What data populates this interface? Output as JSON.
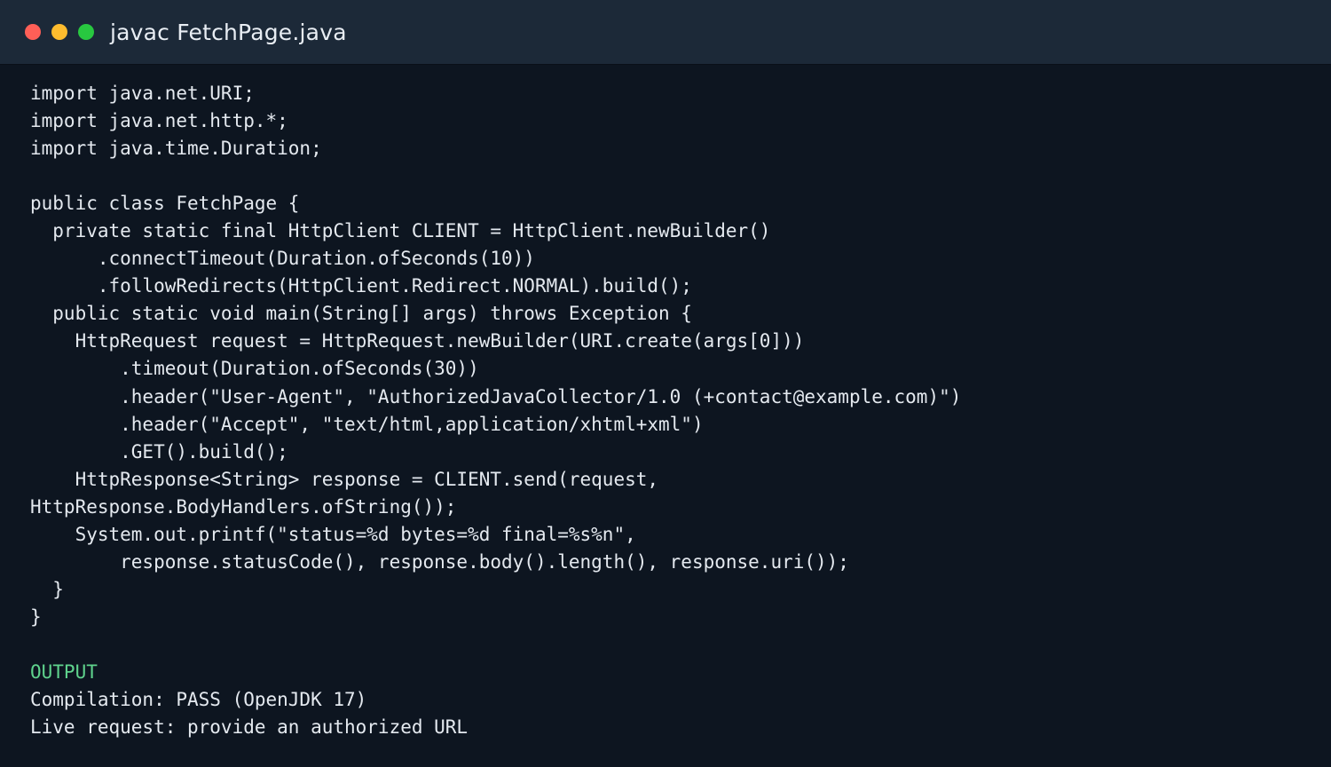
{
  "window": {
    "title": "javac FetchPage.java",
    "controls": [
      "close",
      "minimize",
      "maximize"
    ]
  },
  "editor": {
    "language": "java",
    "code": "import java.net.URI;\nimport java.net.http.*;\nimport java.time.Duration;\n\npublic class FetchPage {\n  private static final HttpClient CLIENT = HttpClient.newBuilder()\n      .connectTimeout(Duration.ofSeconds(10))\n      .followRedirects(HttpClient.Redirect.NORMAL).build();\n  public static void main(String[] args) throws Exception {\n    HttpRequest request = HttpRequest.newBuilder(URI.create(args[0]))\n        .timeout(Duration.ofSeconds(30))\n        .header(\"User-Agent\", \"AuthorizedJavaCollector/1.0 (+contact@example.com)\")\n        .header(\"Accept\", \"text/html,application/xhtml+xml\")\n        .GET().build();\n    HttpResponse<String> response = CLIENT.send(request,\nHttpResponse.BodyHandlers.ofString());\n    System.out.printf(\"status=%d bytes=%d final=%s%n\",\n        response.statusCode(), response.body().length(), response.uri());\n  }\n}"
  },
  "output": {
    "label": "OUTPUT",
    "lines": [
      "Compilation: PASS (OpenJDK 17)",
      "Live request: provide an authorized URL"
    ]
  },
  "colors": {
    "background": "#0d1520",
    "titlebar": "#1c2938",
    "text": "#e4e9ef",
    "output_label": "#5fd38d",
    "close": "#ff5f57",
    "minimize": "#febc2e",
    "maximize": "#28c840"
  }
}
